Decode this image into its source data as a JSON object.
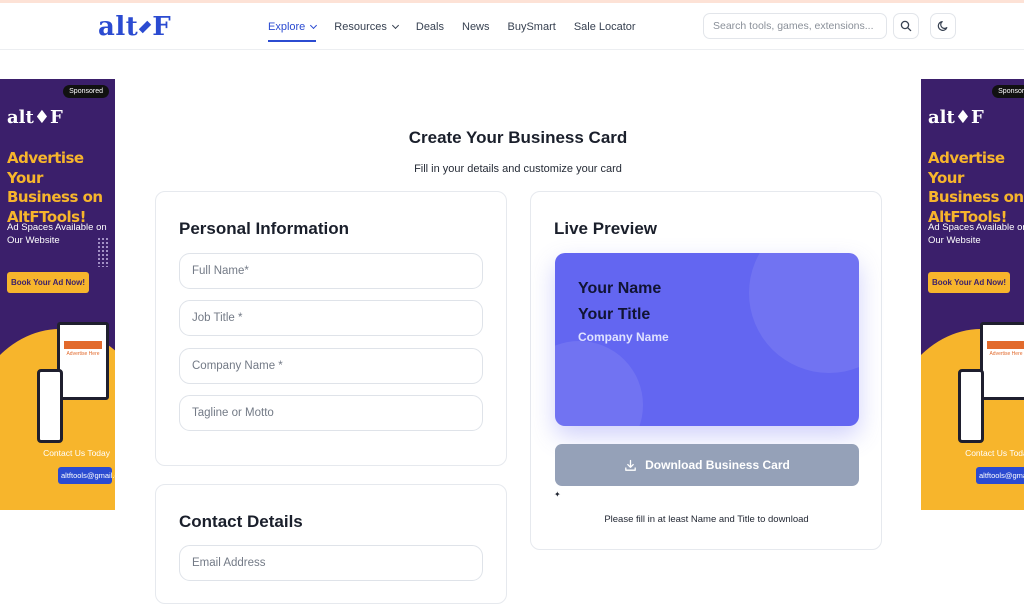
{
  "header": {
    "logo_text": "alt",
    "logo_suffix": "F",
    "nav": [
      {
        "label": "Explore",
        "dropdown": true,
        "active": true
      },
      {
        "label": "Resources",
        "dropdown": true,
        "active": false
      },
      {
        "label": "Deals",
        "dropdown": false,
        "active": false
      },
      {
        "label": "News",
        "dropdown": false,
        "active": false
      },
      {
        "label": "BuySmart",
        "dropdown": false,
        "active": false
      },
      {
        "label": "Sale Locator",
        "dropdown": false,
        "active": false
      }
    ],
    "search_placeholder": "Search tools, games, extensions...",
    "icons": [
      "search-icon",
      "moon-icon"
    ],
    "accent": "#2b4bd1"
  },
  "ads": {
    "sponsored": "Sponsored",
    "logo": "alt♦F",
    "headline": "Advertise Your Business on AltFTools!",
    "subline": "Ad Spaces Available on Our Website",
    "button": "Book Your Ad Now!",
    "contact": "Contact Us Today",
    "email": "altftools@gmail.com",
    "mock_label": "Advertise Here",
    "colors": {
      "bg": "#3b1f6b",
      "accent": "#f7b52c"
    }
  },
  "page": {
    "title": "Create Your Business Card",
    "subtitle": "Fill in your details and customize your card"
  },
  "personal": {
    "heading": "Personal Information",
    "fields": [
      {
        "placeholder": "Full Name*"
      },
      {
        "placeholder": "Job Title *"
      },
      {
        "placeholder": "Company Name *"
      },
      {
        "placeholder": "Tagline or Motto"
      }
    ]
  },
  "contact": {
    "heading": "Contact Details",
    "fields": [
      {
        "placeholder": "Email Address"
      }
    ]
  },
  "preview": {
    "heading": "Live Preview",
    "name": "Your Name",
    "title": "Your Title",
    "company": "Company Name",
    "card_color": "#6366f1",
    "download_label": "Download Business Card",
    "download_icon": "download-icon",
    "hint": "Please fill in at least Name and Title to download"
  }
}
